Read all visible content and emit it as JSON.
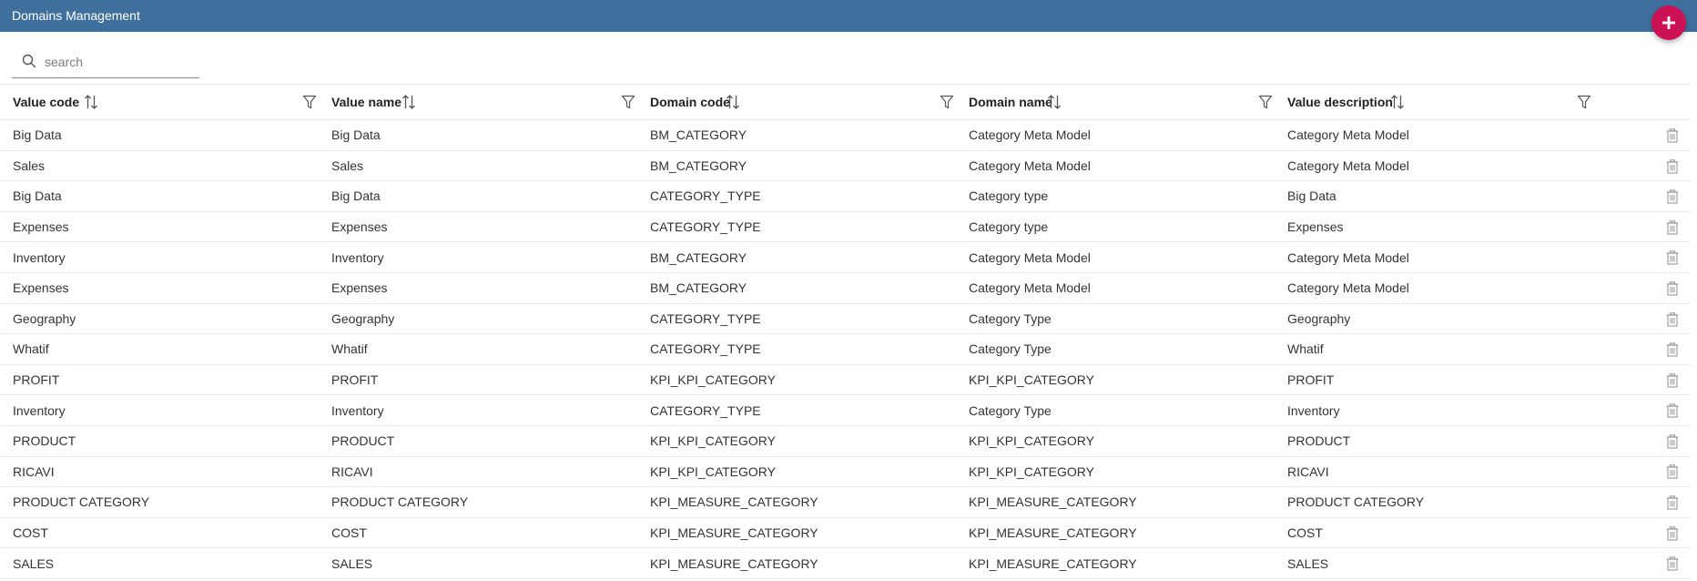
{
  "header": {
    "title": "Domains Management"
  },
  "fab": {
    "icon": "plus-icon"
  },
  "search": {
    "placeholder": "search",
    "value": ""
  },
  "colors": {
    "topbar": "#3f6f9c",
    "fab": "#cc1154"
  },
  "table": {
    "columns": [
      {
        "key": "value_code",
        "label": "Value code"
      },
      {
        "key": "value_name",
        "label": "Value name"
      },
      {
        "key": "domain_code",
        "label": "Domain code"
      },
      {
        "key": "domain_name",
        "label": "Domain name"
      },
      {
        "key": "value_description",
        "label": "Value description"
      }
    ],
    "rows": [
      [
        "Big Data",
        "Big Data",
        "BM_CATEGORY",
        "Category Meta Model",
        "Category Meta Model"
      ],
      [
        "Sales",
        "Sales",
        "BM_CATEGORY",
        "Category Meta Model",
        "Category Meta Model"
      ],
      [
        "Big Data",
        "Big Data",
        "CATEGORY_TYPE",
        "Category type",
        "Big Data"
      ],
      [
        "Expenses",
        "Expenses",
        "CATEGORY_TYPE",
        "Category type",
        "Expenses"
      ],
      [
        "Inventory",
        "Inventory",
        "BM_CATEGORY",
        "Category Meta Model",
        "Category Meta Model"
      ],
      [
        "Expenses",
        "Expenses",
        "BM_CATEGORY",
        "Category Meta Model",
        "Category Meta Model"
      ],
      [
        "Geography",
        "Geography",
        "CATEGORY_TYPE",
        "Category Type",
        "Geography"
      ],
      [
        "Whatif",
        "Whatif",
        "CATEGORY_TYPE",
        "Category Type",
        "Whatif"
      ],
      [
        "PROFIT",
        "PROFIT",
        "KPI_KPI_CATEGORY",
        "KPI_KPI_CATEGORY",
        "PROFIT"
      ],
      [
        "Inventory",
        "Inventory",
        "CATEGORY_TYPE",
        "Category Type",
        "Inventory"
      ],
      [
        "PRODUCT",
        "PRODUCT",
        "KPI_KPI_CATEGORY",
        "KPI_KPI_CATEGORY",
        "PRODUCT"
      ],
      [
        "RICAVI",
        "RICAVI",
        "KPI_KPI_CATEGORY",
        "KPI_KPI_CATEGORY",
        "RICAVI"
      ],
      [
        "PRODUCT CATEGORY",
        "PRODUCT CATEGORY",
        "KPI_MEASURE_CATEGORY",
        "KPI_MEASURE_CATEGORY",
        "PRODUCT CATEGORY"
      ],
      [
        "COST",
        "COST",
        "KPI_MEASURE_CATEGORY",
        "KPI_MEASURE_CATEGORY",
        "COST"
      ],
      [
        "SALES",
        "SALES",
        "KPI_MEASURE_CATEGORY",
        "KPI_MEASURE_CATEGORY",
        "SALES"
      ]
    ]
  }
}
